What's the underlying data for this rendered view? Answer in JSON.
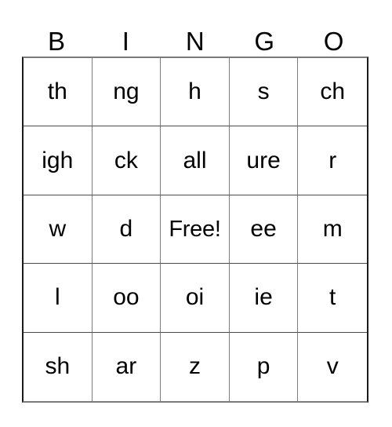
{
  "card": {
    "title": "BINGO",
    "header_letters": [
      "B",
      "I",
      "N",
      "G",
      "O"
    ],
    "colors": {
      "background": "#ffffff",
      "text": "#000000",
      "grid_line": "#7d7d7d",
      "grid_border": "#1b1b1b"
    },
    "grid": {
      "columns": 5,
      "rows": 5,
      "free_space": "Free!",
      "free_space_position": {
        "row": 3,
        "column": 3
      },
      "cells": [
        [
          {
            "value": "th"
          },
          {
            "value": "ng"
          },
          {
            "value": "h"
          },
          {
            "value": "s"
          },
          {
            "value": "ch"
          }
        ],
        [
          {
            "value": "igh"
          },
          {
            "value": "ck"
          },
          {
            "value": "all"
          },
          {
            "value": "ure"
          },
          {
            "value": "r"
          }
        ],
        [
          {
            "value": "w"
          },
          {
            "value": "d"
          },
          {
            "value": "Free!"
          },
          {
            "value": "ee"
          },
          {
            "value": "m"
          }
        ],
        [
          {
            "value": "l"
          },
          {
            "value": "oo"
          },
          {
            "value": "oi"
          },
          {
            "value": "ie"
          },
          {
            "value": "t"
          }
        ],
        [
          {
            "value": "sh"
          },
          {
            "value": "ar"
          },
          {
            "value": "z"
          },
          {
            "value": "p"
          },
          {
            "value": "v"
          }
        ]
      ]
    }
  }
}
